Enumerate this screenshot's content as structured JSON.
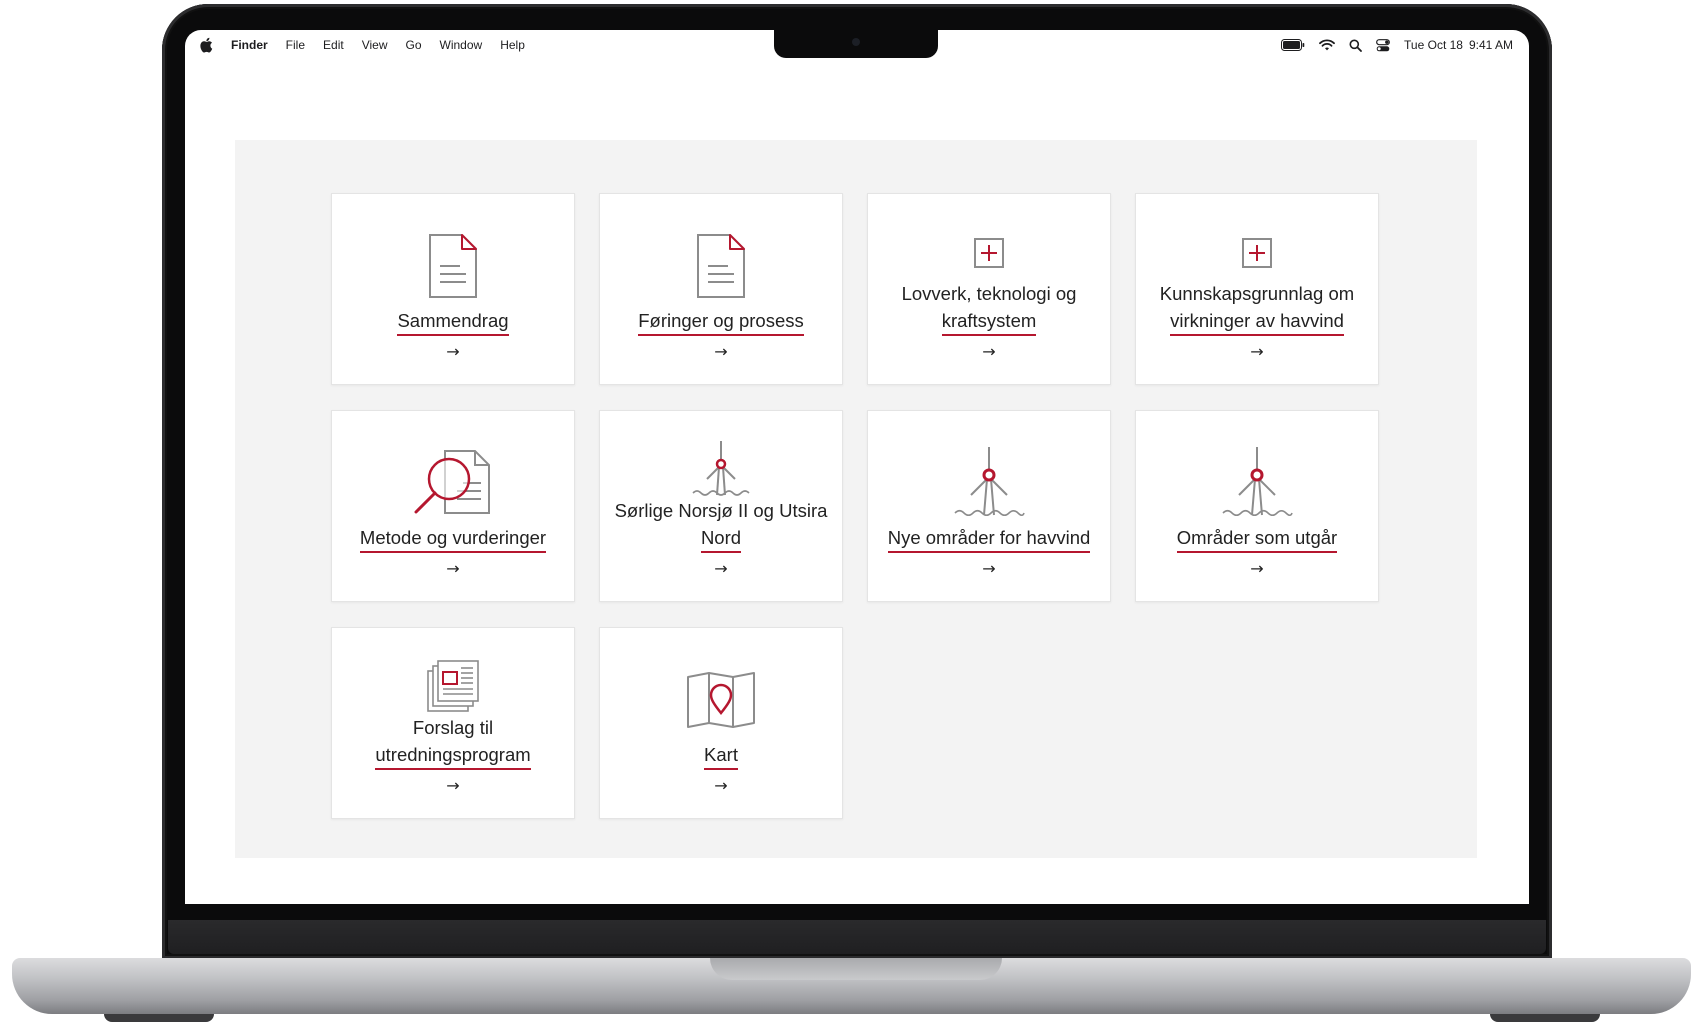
{
  "menubar": {
    "app_name": "Finder",
    "items": [
      "File",
      "Edit",
      "View",
      "Go",
      "Window",
      "Help"
    ],
    "status_icons": [
      "battery-icon",
      "wifi-icon",
      "spotlight-search-icon",
      "control-center-icon"
    ],
    "date": "Tue Oct 18",
    "time": "9:41 AM"
  },
  "theme": {
    "accent": "#b5172f",
    "panel_bg": "#f3f3f3",
    "card_bg": "#ffffff",
    "icon_gray": "#8c8c8c"
  },
  "cards": [
    {
      "line1": "",
      "line2": "Sammendrag",
      "icon": "document-icon"
    },
    {
      "line1": "",
      "line2": "Føringer og prosess",
      "icon": "document-icon"
    },
    {
      "line1": "Lovverk, teknologi og",
      "line2": "kraftsystem",
      "icon": "expand-box-icon"
    },
    {
      "line1": "Kunnskapsgrunnlag om",
      "line2": "virkninger av havvind",
      "icon": "expand-box-icon"
    },
    {
      "line1": "",
      "line2": "Metode og vurderinger",
      "icon": "magnifier-document-icon"
    },
    {
      "line1": "Sørlige Norsjø II og Utsira",
      "line2": "Nord",
      "icon": "wind-turbine-icon"
    },
    {
      "line1": "",
      "line2": "Nye områder for havvind",
      "icon": "wind-turbine-icon"
    },
    {
      "line1": "",
      "line2": "Områder som utgår",
      "icon": "wind-turbine-icon"
    },
    {
      "line1": "Forslag til",
      "line2": "utredningsprogram",
      "icon": "stacked-documents-icon"
    },
    {
      "line1": "",
      "line2": "Kart",
      "icon": "map-pin-icon"
    }
  ],
  "arrow_glyph": "→"
}
